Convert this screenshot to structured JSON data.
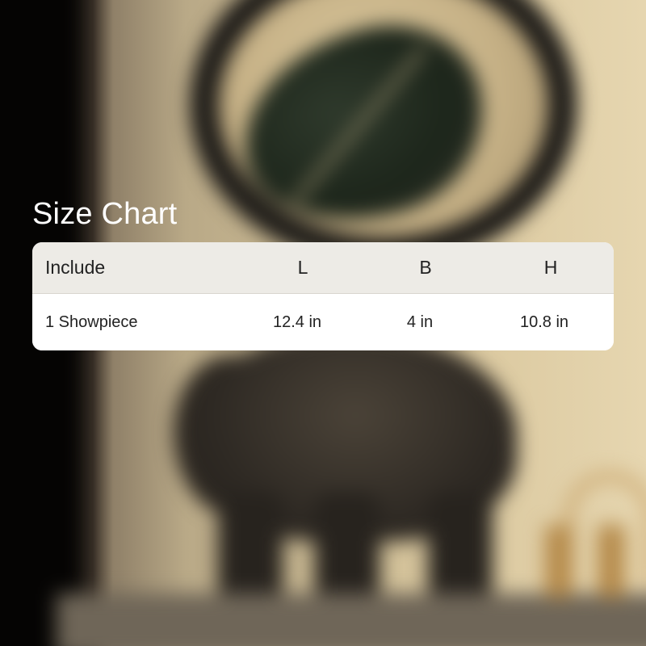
{
  "title": "Size Chart",
  "table": {
    "headers": {
      "include": "Include",
      "length": "L",
      "breadth": "B",
      "height": "H"
    },
    "rows": [
      {
        "include": "1 Showpiece",
        "length": "12.4 in",
        "breadth": "4 in",
        "height": "10.8 in"
      }
    ]
  },
  "colors": {
    "title_text": "#ffffff",
    "header_background": "#edebe6",
    "row_background": "#ffffff",
    "cell_text": "#222222"
  }
}
